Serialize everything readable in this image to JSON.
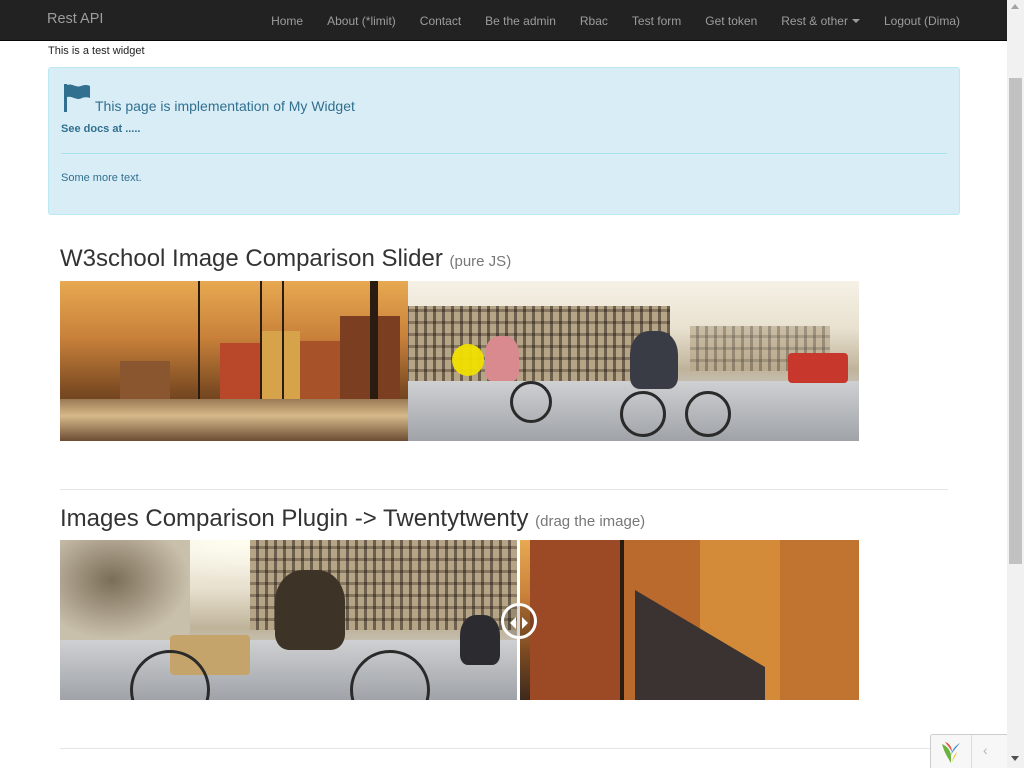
{
  "navbar": {
    "brand": "Rest API",
    "items": [
      {
        "label": "Home"
      },
      {
        "label": "About (*limit)"
      },
      {
        "label": "Contact"
      },
      {
        "label": "Be the admin"
      },
      {
        "label": "Rbac"
      },
      {
        "label": "Test form"
      },
      {
        "label": "Get token"
      },
      {
        "label": "Rest & other"
      },
      {
        "label": "Logout (Dima)"
      }
    ]
  },
  "content": {
    "test_widget_text": "This is a test widget",
    "alert": {
      "title": "This page is implementation of My Widget",
      "docs": "See docs at .....",
      "more": "Some more text.",
      "icon": "flag-icon"
    },
    "section1": {
      "title": "W3school Image Comparison Slider",
      "subtitle": "(pure JS)"
    },
    "section2": {
      "title": "Images Comparison Plugin -> Twentytwenty",
      "subtitle": "(drag the image)"
    }
  },
  "debug_toolbar": {
    "collapse": "‹",
    "logo_icon": "yii-logo-icon"
  },
  "colors": {
    "navbar_bg": "#222222",
    "nav_text": "#9d9d9d",
    "alert_bg": "#d9edf7",
    "alert_text": "#31708f",
    "slider_handle": "#f2e000"
  }
}
